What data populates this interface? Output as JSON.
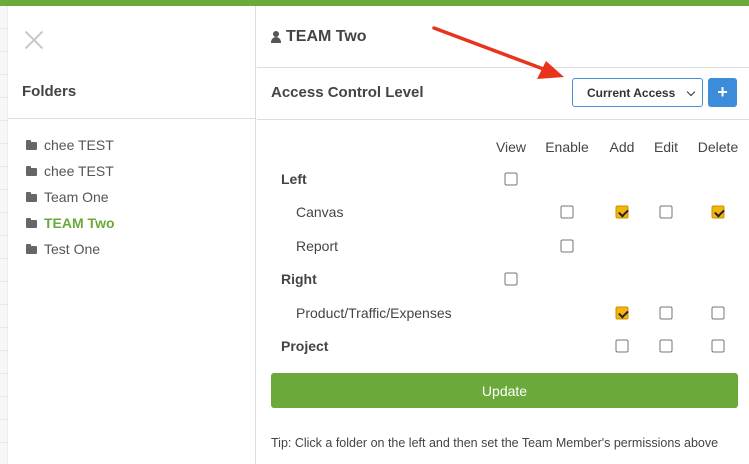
{
  "colors": {
    "accent_green": "#6aa93a",
    "primary_blue": "#3c8dd9",
    "checkbox_checked": "#f5b50d",
    "annotation_red": "#e8341c"
  },
  "sidebar": {
    "title": "Folders",
    "close_icon": "close-icon",
    "folders": [
      {
        "label": "chee TEST",
        "active": false
      },
      {
        "label": "chee TEST",
        "active": false
      },
      {
        "label": "Team One",
        "active": false
      },
      {
        "label": "TEAM Two",
        "active": true
      },
      {
        "label": "Test One",
        "active": false
      }
    ]
  },
  "main": {
    "team_name": "TEAM Two",
    "acl_title": "Access Control Level",
    "access_select": {
      "value": "Current Access"
    },
    "add_button_label": "+",
    "columns": [
      "View",
      "Enable",
      "Add",
      "Edit",
      "Delete"
    ],
    "rows": [
      {
        "label": "Left",
        "group": true,
        "checks": {
          "View": false
        }
      },
      {
        "label": "Canvas",
        "group": false,
        "checks": {
          "Enable": false,
          "Add": true,
          "Edit": false,
          "Delete": true
        }
      },
      {
        "label": "Report",
        "group": false,
        "checks": {
          "Enable": false
        }
      },
      {
        "label": "Right",
        "group": true,
        "checks": {
          "View": false
        }
      },
      {
        "label": "Product/Traffic/Expenses",
        "group": false,
        "checks": {
          "Add": true,
          "Edit": false,
          "Delete": false
        }
      },
      {
        "label": "Project",
        "group": true,
        "checks": {
          "Add": false,
          "Edit": false,
          "Delete": false
        }
      }
    ],
    "update_label": "Update",
    "tip": "Tip: Click a folder on the left and then set the Team Member's permissions above"
  }
}
